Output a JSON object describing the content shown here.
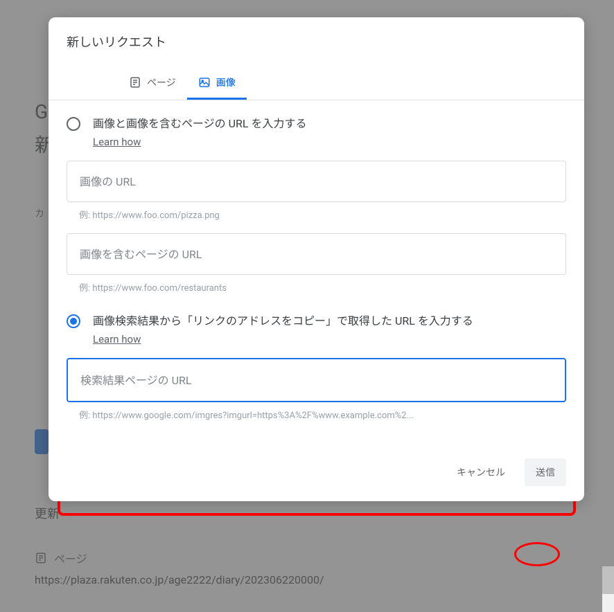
{
  "background": {
    "heading1": "G",
    "heading2": "新",
    "subtext": "カ",
    "update": "更新",
    "pageLabel": "ページ",
    "url": "https://plaza.rakuten.co.jp/age2222/diary/202306220000/"
  },
  "modal": {
    "title": "新しいリクエスト",
    "tabs": {
      "page": "ページ",
      "image": "画像"
    },
    "option1": {
      "label": "画像と画像を含むページの URL を入力する",
      "learn": "Learn how",
      "input1_placeholder": "画像の URL",
      "input1_example": "例: https://www.foo.com/pizza.png",
      "input2_placeholder": "画像を含むページの URL",
      "input2_example": "例: https://www.foo.com/restaurants"
    },
    "option2": {
      "label": "画像検索結果から「リンクのアドレスをコピー」で取得した URL を入力する",
      "learn": "Learn how",
      "input_placeholder": "検索結果ページの URL",
      "input_example": "例: https://www.google.com/imgres?imgurl=https%3A%2F%www.example.com%2..."
    },
    "actions": {
      "cancel": "キャンセル",
      "submit": "送信"
    }
  }
}
